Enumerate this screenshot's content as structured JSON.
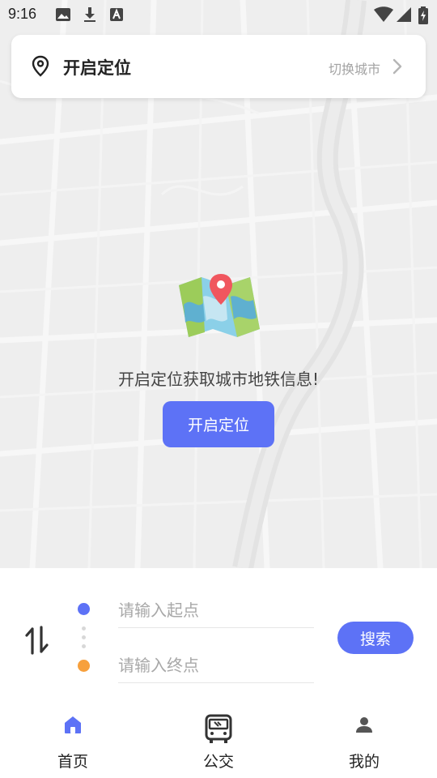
{
  "status_bar": {
    "time": "9:16",
    "icons": [
      "image-icon",
      "download-icon",
      "keyboard-a-icon",
      "wifi-icon",
      "signal-icon",
      "battery-charging-icon"
    ]
  },
  "location_card": {
    "title": "开启定位",
    "switch_city_label": "切换城市",
    "icons": [
      "location-pin-icon",
      "chevron-right-icon"
    ]
  },
  "center": {
    "prompt": "开启定位获取城市地铁信息!",
    "enable_button_label": "开启定位",
    "illustration": "map-with-pin-icon"
  },
  "route": {
    "start_placeholder": "请输入起点",
    "end_placeholder": "请输入终点",
    "search_button_label": "搜索",
    "start_value": "",
    "end_value": ""
  },
  "bottom_nav": {
    "items": [
      {
        "label": "首页",
        "icon": "home-icon",
        "active": true
      },
      {
        "label": "公交",
        "icon": "bus-icon",
        "active": false
      },
      {
        "label": "我的",
        "icon": "person-icon",
        "active": false
      }
    ]
  },
  "colors": {
    "accent": "#5d72f6",
    "start_dot": "#5d72f6",
    "end_dot": "#f7a03c",
    "map_background": "#eeeeee"
  }
}
